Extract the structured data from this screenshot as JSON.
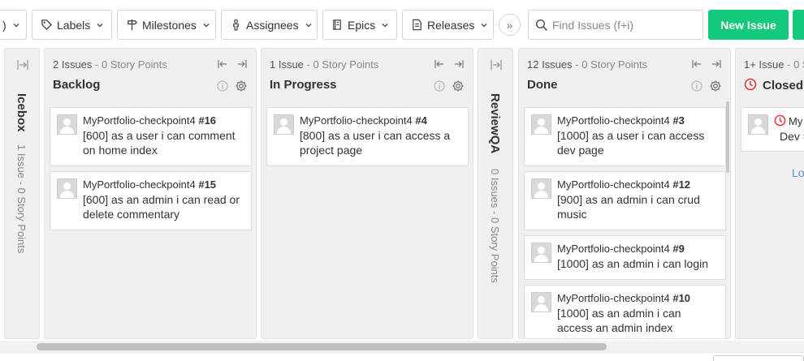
{
  "toolbar": {
    "prev_fragment": ")",
    "labels": "Labels",
    "milestones": "Milestones",
    "assignees": "Assignees",
    "epics": "Epics",
    "releases": "Releases",
    "more": "»",
    "search_placeholder": "Find Issues (f+i)",
    "new_issue": "New Issue"
  },
  "columns": {
    "icebox": {
      "title": "Icebox",
      "count": "1 Issue",
      "points": " - 0 Story Points"
    },
    "backlog": {
      "count": "2 Issues",
      "points": " - 0 Story Points",
      "title": "Backlog",
      "cards": [
        {
          "project": "MyPortfolio-checkpoint4 ",
          "number": "#16",
          "text": "[600] as a user i can comment on home index"
        },
        {
          "project": "MyPortfolio-checkpoint4 ",
          "number": "#15",
          "text": "[600] as an admin i can read or delete commentary"
        }
      ]
    },
    "in_progress": {
      "count": "1 Issue",
      "points": " - 0 Story Points",
      "title": "In Progress",
      "cards": [
        {
          "project": "MyPortfolio-checkpoint4 ",
          "number": "#4",
          "text": "[800] as a user i can access a project page"
        }
      ]
    },
    "review_qa": {
      "title": "ReviewQA",
      "count": "0 Issues",
      "points": " - 0 Story Points"
    },
    "done": {
      "count": "12 Issues",
      "points": " - 0 Story Points",
      "title": "Done",
      "cards": [
        {
          "project": "MyPortfolio-checkpoint4 ",
          "number": "#3",
          "text": "[1000] as a user i can access dev page"
        },
        {
          "project": "MyPortfolio-checkpoint4 ",
          "number": "#12",
          "text": "[900] as an admin i can crud music"
        },
        {
          "project": "MyPortfolio-checkpoint4 ",
          "number": "#9",
          "text": "[1000] as an admin i can login"
        },
        {
          "project": "MyPortfolio-checkpoint4 ",
          "number": "#10",
          "text": "[1000] as an admin i can access an admin index"
        }
      ]
    },
    "closed": {
      "count": "1+ Issue",
      "points": " - 0 S",
      "title": "Closed",
      "cards": [
        {
          "project": "My",
          "text": "Dev ="
        }
      ],
      "load_more": "Lo"
    }
  },
  "colors": {
    "accent_green": "#13c97b",
    "closed_red": "#e0383e",
    "link_blue": "#5b8dd6"
  },
  "icons": {
    "labels": "tag-icon",
    "milestones": "signpost-icon",
    "assignees": "person-icon",
    "epics": "book-icon",
    "releases": "document-icon",
    "search": "search-icon",
    "collapse": "collapse-icon",
    "expand": "expand-icon",
    "info": "info-icon",
    "settings": "gear-icon",
    "closed": "closed-issue-icon"
  }
}
